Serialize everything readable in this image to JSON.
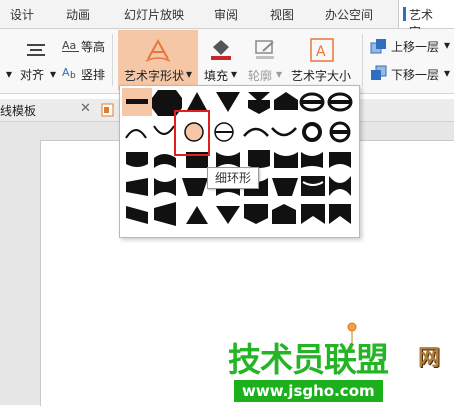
{
  "tabs": [
    "设计",
    "动画",
    "幻灯片放映",
    "审阅",
    "视图",
    "办公空间",
    "艺术字"
  ],
  "ribbon": {
    "equal_height": "等高",
    "vertical": "竖排",
    "align": "对齐",
    "wordart_shape": "艺术字形状",
    "fill": "填充",
    "outline": "轮廓",
    "wordart_size": "艺术字大小",
    "bring_forward": "上移一层",
    "send_backward": "下移一层"
  },
  "docbar": {
    "template_label": "线模板"
  },
  "tooltip": "细环形",
  "watermark": {
    "title": "技术员联盟",
    "url": "www.jsgho.com",
    "suffix": "网"
  },
  "colors": {
    "selection": "#e02020",
    "highlight": "#f5c7a6",
    "accent": "#2e6fbf"
  }
}
